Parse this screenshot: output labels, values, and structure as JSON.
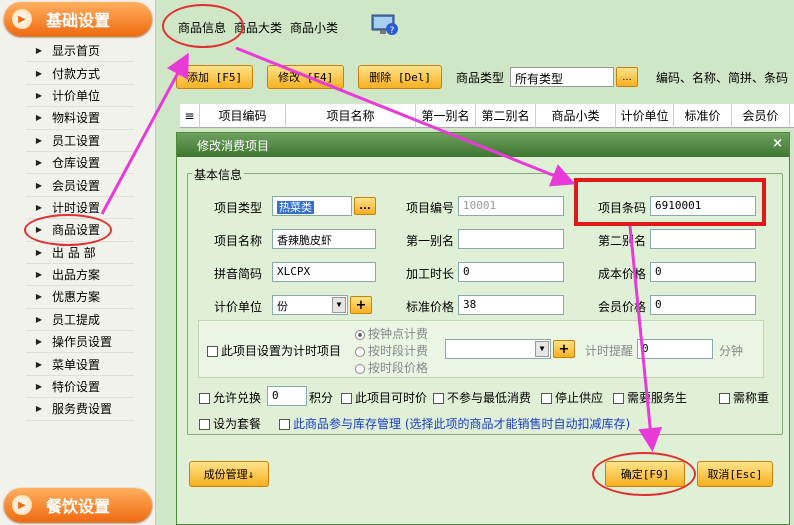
{
  "sidebar": {
    "top_label": "基础设置",
    "bottom_label": "餐饮设置",
    "items": [
      {
        "label": "显示首页"
      },
      {
        "label": "付款方式"
      },
      {
        "label": "计价单位"
      },
      {
        "label": "物料设置"
      },
      {
        "label": "员工设置"
      },
      {
        "label": "仓库设置"
      },
      {
        "label": "会员设置"
      },
      {
        "label": "计时设置"
      },
      {
        "label": "商品设置"
      },
      {
        "label": "出 品 部"
      },
      {
        "label": "出品方案"
      },
      {
        "label": "优惠方案"
      },
      {
        "label": "员工提成"
      },
      {
        "label": "操作员设置"
      },
      {
        "label": "菜单设置"
      },
      {
        "label": "特价设置"
      },
      {
        "label": "服务费设置"
      }
    ]
  },
  "tabs": [
    "商品信息",
    "商品大类",
    "商品小类"
  ],
  "toolbar": {
    "add": "添加 [F5]",
    "edit": "修改 [F4]",
    "delete": "删除 [Del]",
    "type_label": "商品类型",
    "type_value": "所有类型",
    "dots": "...",
    "search_hint": "编码、名称、简拼、条码"
  },
  "grid_columns": [
    "项目编码",
    "项目名称",
    "第一别名",
    "第二别名",
    "商品小类",
    "计价单位",
    "标准价",
    "会员价"
  ],
  "dialog": {
    "title": "修改消费项目",
    "close": "×",
    "group_label": "基本信息",
    "type_label": "项目类型",
    "type_value": "热菜类",
    "dots": "...",
    "code_label": "项目编号",
    "code_value": "10001",
    "barcode_label": "项目条码",
    "barcode_value": "6910001",
    "name_label": "项目名称",
    "name_value": "香辣脆皮虾",
    "alias1_label": "第一别名",
    "alias1_value": "",
    "alias2_label": "第二别名",
    "alias2_value": "",
    "pinyin_label": "拼音简码",
    "pinyin_value": "XLCPX",
    "time_label": "加工时长",
    "time_value": "0",
    "cost_label": "成本价格",
    "cost_value": "0",
    "unit_label": "计价单位",
    "unit_value": "份",
    "plus": "+",
    "std_label": "标准价格",
    "std_value": "38",
    "member_label": "会员价格",
    "member_value": "0",
    "timed_item": "此项目设置为计时项目",
    "radio1": "按钟点计费",
    "radio2": "按时段计费",
    "radio3": "按时段价格",
    "remind_label": "计时提醒",
    "remind_value": "0",
    "minute": "分钟",
    "allow_exchange": "允许兑换",
    "exchange_value": "0",
    "points": "积分",
    "timed_price": "此项目可时价",
    "min_spend": "不参与最低消费",
    "stop_supply": "停止供应",
    "need_service": "需要服务生",
    "need_weigh": "需称重",
    "set_combo": "设为套餐",
    "inventory": "此商品参与库存管理 (选择此项的商品才能销售时自动扣减库存)",
    "cost_mgmt": "成份管理↓",
    "ok": "确定[F9]",
    "cancel": "取消[Esc]"
  },
  "colors": {
    "orange": "#f06a10",
    "green_title": "#3e7630",
    "highlight": "#e01818",
    "arrow": "#e83ad8"
  }
}
